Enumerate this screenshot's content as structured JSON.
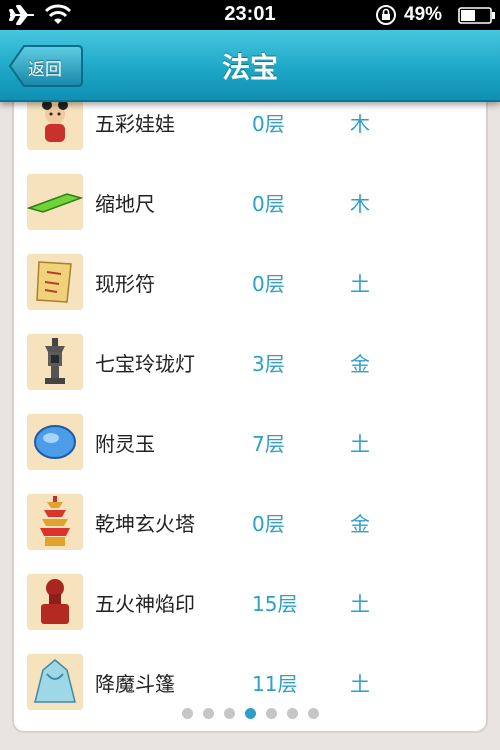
{
  "status_bar": {
    "time": "23:01",
    "battery": "49%",
    "icons": [
      "airplane-icon",
      "wifi-icon",
      "rotation-lock-icon",
      "battery-icon"
    ]
  },
  "nav": {
    "title": "法宝",
    "back_label": "返回"
  },
  "items": [
    {
      "name": "五彩娃娃",
      "level": "0层",
      "element": "木",
      "icon": "doll-icon"
    },
    {
      "name": "缩地尺",
      "level": "0层",
      "element": "木",
      "icon": "ruler-icon"
    },
    {
      "name": "现形符",
      "level": "0层",
      "element": "土",
      "icon": "talisman-scroll-icon"
    },
    {
      "name": "七宝玲珑灯",
      "level": "3层",
      "element": "金",
      "icon": "lantern-icon"
    },
    {
      "name": "附灵玉",
      "level": "7层",
      "element": "土",
      "icon": "jade-icon"
    },
    {
      "name": "乾坤玄火塔",
      "level": "0层",
      "element": "金",
      "icon": "pagoda-icon"
    },
    {
      "name": "五火神焰印",
      "level": "15层",
      "element": "土",
      "icon": "seal-icon"
    },
    {
      "name": "降魔斗篷",
      "level": "11层",
      "element": "土",
      "icon": "cloak-icon"
    }
  ],
  "pagination": {
    "total": 7,
    "current": 4
  },
  "colors": {
    "accent": "#2e9fc9",
    "nav_bar": "#1ea7c8",
    "thumb_bg": "#f6e3bd"
  }
}
